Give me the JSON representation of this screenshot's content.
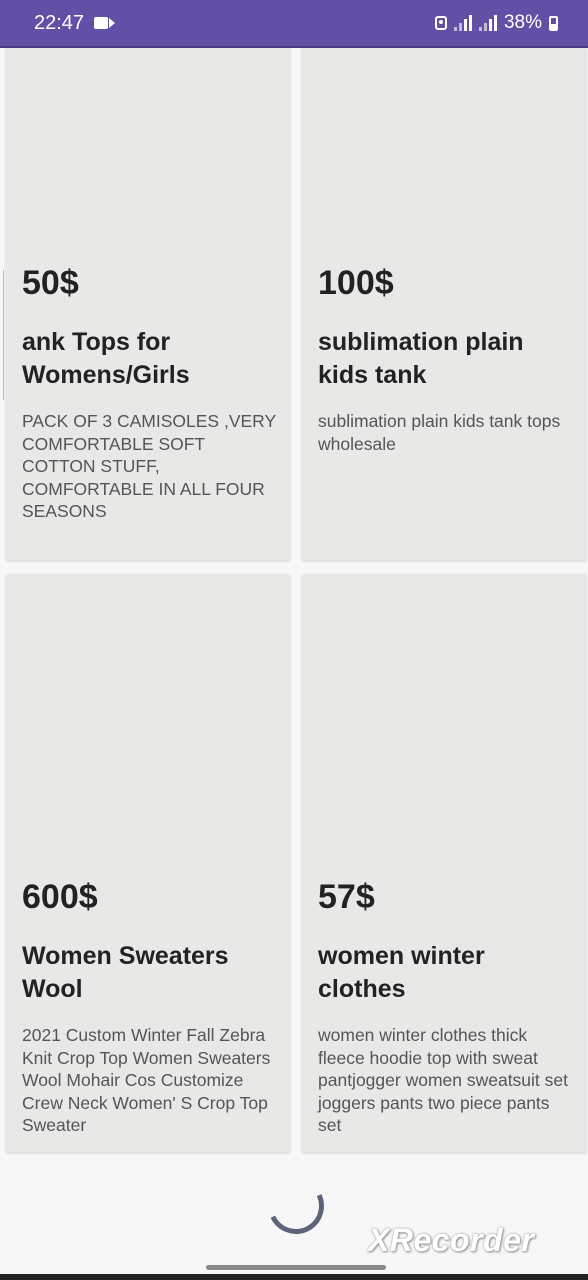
{
  "status_bar": {
    "time": "22:47",
    "battery": "38%",
    "accent_color": "#6250a7"
  },
  "products": [
    {
      "price": "50$",
      "title": "ank Tops for Womens/Girls",
      "description": "PACK OF 3 CAMISOLES ,VERY COMFORTABLE SOFT COTTON STUFF, COMFORTABLE IN ALL FOUR SEASONS"
    },
    {
      "price": "100$",
      "title": "sublimation plain kids tank",
      "description": "sublimation plain kids tank tops wholesale"
    },
    {
      "price": "600$",
      "title": "Women Sweaters Wool",
      "description": "2021 Custom Winter Fall Zebra Knit Crop Top Women Sweaters Wool Mohair Cos Customize Crew Neck Women' S Crop Top Sweater"
    },
    {
      "price": "57$",
      "title": "women winter clothes",
      "description": "women winter clothes thick fleece hoodie top with sweat pantjogger women sweatsuit set joggers pants two piece pants set"
    }
  ],
  "watermark": "XRecorder",
  "icons": {
    "recording": "video-record-icon",
    "lock": "lock-icon",
    "signal": "signal-icon",
    "battery": "battery-icon",
    "loading": "loading-spinner"
  }
}
